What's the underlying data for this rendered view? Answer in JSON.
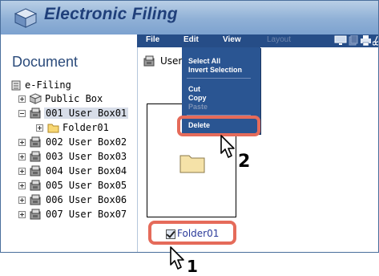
{
  "app": {
    "title": "Electronic Filing"
  },
  "menubar": {
    "items": [
      {
        "label": "File",
        "enabled": true
      },
      {
        "label": "Edit",
        "enabled": true
      },
      {
        "label": "View",
        "enabled": true
      },
      {
        "label": "Layout",
        "enabled": false
      }
    ],
    "toolbar_icons": [
      "monitor-icon",
      "pages-icon",
      "print-icon",
      "scissors-icon"
    ]
  },
  "sidebar": {
    "title": "Document",
    "tree": [
      {
        "label": "e-Filing",
        "icon": "filing-root-icon"
      },
      {
        "label": "Public Box",
        "icon": "public-box-icon",
        "expander": "plus"
      },
      {
        "label": "001 User Box01",
        "icon": "user-box-icon",
        "expander": "minus",
        "selected": true
      },
      {
        "label": "Folder01",
        "icon": "folder-icon",
        "expander": "plus"
      },
      {
        "label": "002 User Box02",
        "icon": "user-box-icon",
        "expander": "plus"
      },
      {
        "label": "003 User Box03",
        "icon": "user-box-icon",
        "expander": "plus"
      },
      {
        "label": "004 User Box04",
        "icon": "user-box-icon",
        "expander": "plus"
      },
      {
        "label": "005 User Box05",
        "icon": "user-box-icon",
        "expander": "plus"
      },
      {
        "label": "006 User Box06",
        "icon": "user-box-icon",
        "expander": "plus"
      },
      {
        "label": "007 User Box07",
        "icon": "user-box-icon",
        "expander": "plus"
      }
    ]
  },
  "main": {
    "breadcrumb": "User",
    "item": {
      "label": "Folder01",
      "checked": true
    }
  },
  "edit_menu": {
    "items": [
      {
        "label": "Select All",
        "enabled": true
      },
      {
        "label": "Invert Selection",
        "enabled": true
      },
      {
        "label": "Cut",
        "enabled": true
      },
      {
        "label": "Copy",
        "enabled": true
      },
      {
        "label": "Paste",
        "enabled": false
      },
      {
        "label": "Delete",
        "enabled": true,
        "highlighted": true
      }
    ]
  },
  "callouts": {
    "step1": "1",
    "step2": "2"
  },
  "colors": {
    "highlight_border": "#e56b5a",
    "menubar_bg": "#264d87",
    "title_text": "#1f3f7a"
  }
}
